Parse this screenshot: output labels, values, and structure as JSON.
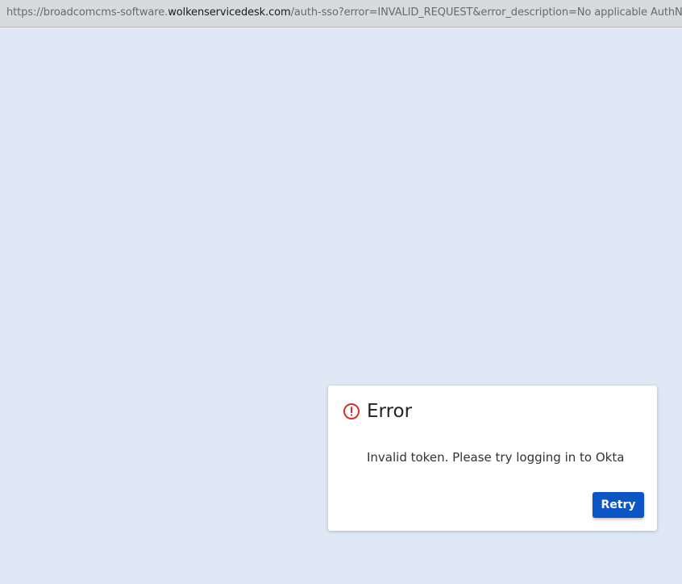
{
  "browser": {
    "url_prefix": "https://broadcomcms-software.",
    "url_domain": "wolkenservicedesk.com",
    "url_rest": "/auth-sso?error=INVALID_REQUEST&error_description=No applicable AuthN policies co"
  },
  "dialog": {
    "icon": "error-circle-icon",
    "title": "Error",
    "message": "Invalid token. Please try logging in to Okta",
    "retry_label": "Retry",
    "accent_color": "#d93025",
    "button_color": "#0b55c4"
  }
}
